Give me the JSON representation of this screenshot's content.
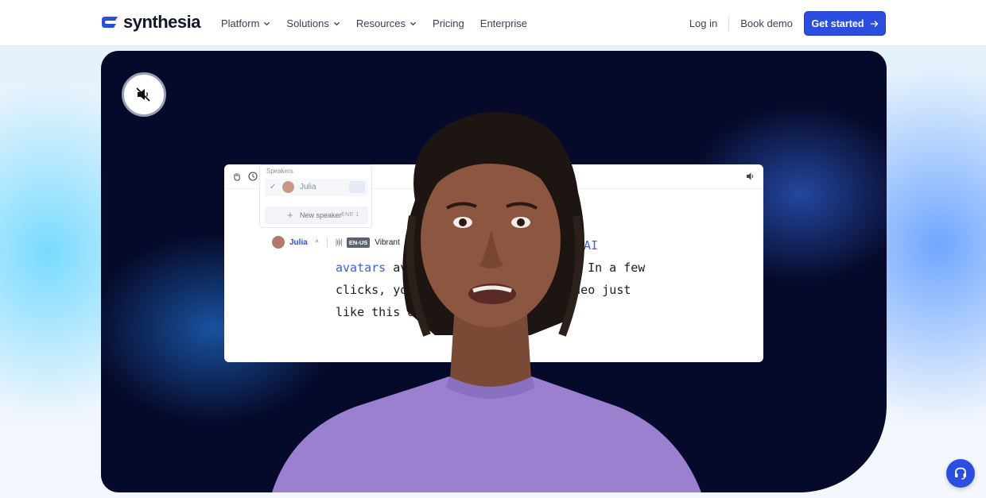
{
  "brand": {
    "name": "synthesia",
    "color": "#2b4de0"
  },
  "nav": {
    "items": [
      {
        "label": "Platform",
        "has_dropdown": true
      },
      {
        "label": "Solutions",
        "has_dropdown": true
      },
      {
        "label": "Resources",
        "has_dropdown": true
      },
      {
        "label": "Pricing",
        "has_dropdown": false
      },
      {
        "label": "Enterprise",
        "has_dropdown": false
      }
    ],
    "login": "Log in",
    "book_demo": "Book demo",
    "cta": "Get started"
  },
  "video": {
    "mute_icon": "speaker-muted-icon",
    "editor": {
      "speakers_heading": "Speakers",
      "speaker_name": "Julia",
      "new_speaker": "New speaker",
      "scene_label": "ENE 1",
      "bar_speaker": "Julia",
      "language": "EN-US",
      "voice": "Vibrant",
      "script_line1_highlight": "AI",
      "script_line2_highlight": "avatars",
      "script_line2_rest": " avail",
      "script_line2_tail": "a. In a few",
      "script_line3": "clicks, you c",
      "script_line3_tail": "ee video just",
      "script_line4": "like this on"
    }
  },
  "help": {
    "icon": "headset-icon"
  }
}
